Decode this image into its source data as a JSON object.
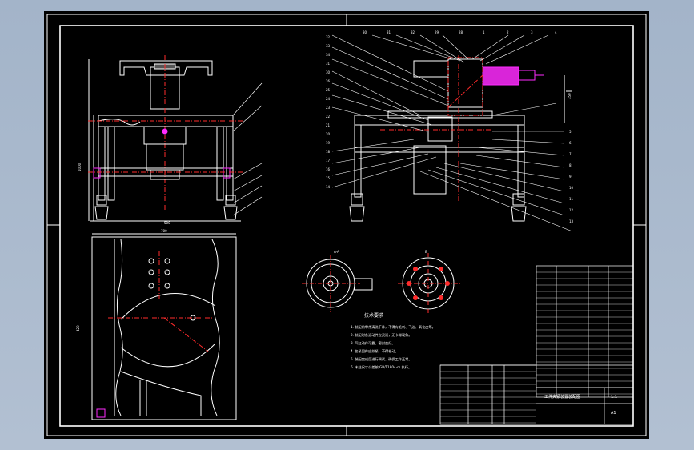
{
  "viewer": {
    "background_color": "#a9b9cd",
    "sheet_color": "#000000"
  },
  "drawing": {
    "line_color": "#ffffff",
    "center_line_color": "#ff2b2b",
    "hidden_feature_color": "#ff2bff",
    "leader_color": "#ffffff",
    "edge_tick_labels": [
      "1",
      "2",
      "3",
      "4"
    ],
    "leader_numbers_top": [
      "30",
      "31",
      "32",
      "29",
      "28",
      "1",
      "2",
      "3",
      "4"
    ],
    "leader_numbers_left": [
      "32",
      "33",
      "34",
      "31",
      "30",
      "26",
      "25",
      "24",
      "23",
      "22",
      "21",
      "20",
      "19",
      "18",
      "17",
      "16",
      "15",
      "14"
    ],
    "leader_numbers_right": [
      "5",
      "6",
      "7",
      "8",
      "9",
      "10",
      "11",
      "12",
      "13"
    ],
    "section_label_a": "A-A",
    "section_label_b": "B",
    "tech_req_title": "技术要求",
    "tech_requirements": [
      "1. 装配前零件清洗干净，不得有毛刺、飞边、氧化皮等。",
      "2. 装配时各运动件应灵活，无卡滞现象。",
      "3. 气缸动作可靠，密封良好。",
      "4. 各紧固件应拧紧，不得松动。",
      "5. 装配完成后进行调试，确保工作正常。",
      "6. 未注尺寸公差按 GB/T1804-m 执行。"
    ],
    "dimension_labels": [
      "1000",
      "500",
      "700",
      "420",
      "350"
    ]
  },
  "title_block": {
    "name": "工件夹紧装置装配图",
    "scale": "1:1",
    "sheet": "A1"
  }
}
